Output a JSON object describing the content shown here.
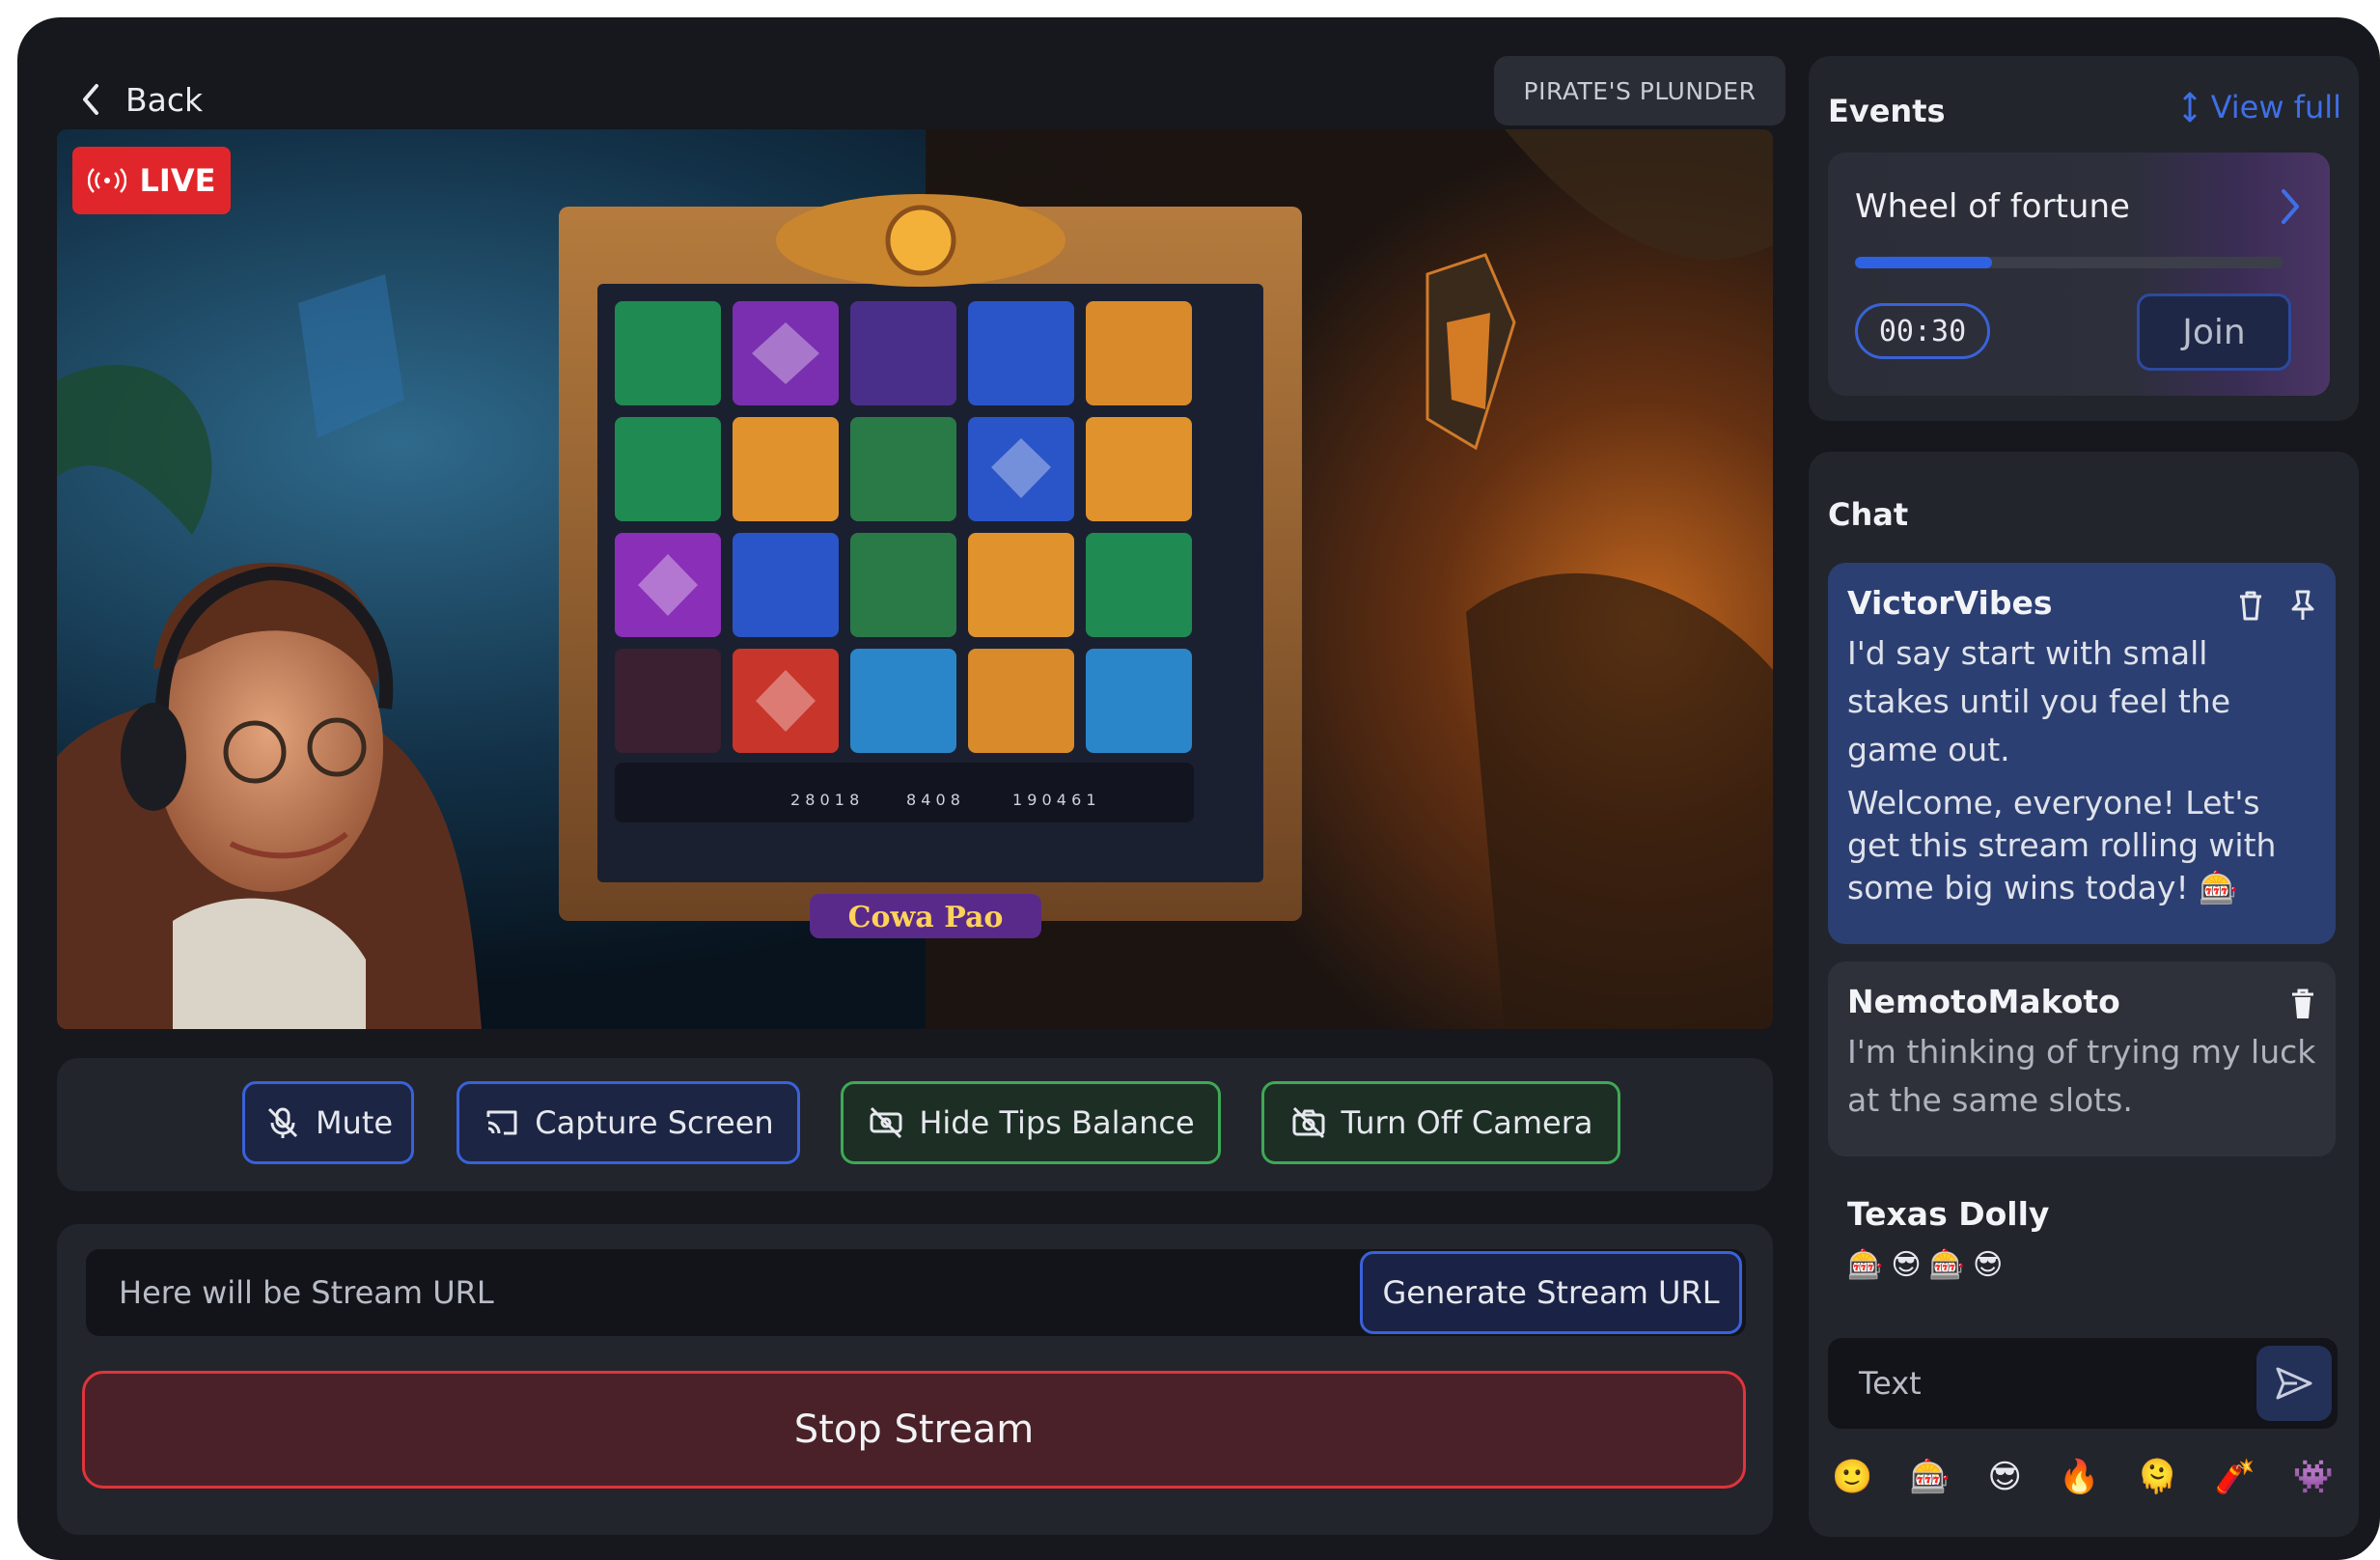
{
  "header": {
    "back_label": "Back",
    "game_name": "PIRATE'S PLUNDER"
  },
  "video": {
    "live_label": "LIVE",
    "slot_title": "Cowa Pao",
    "slot_stats": [
      "2 8 0 1 8",
      "8 4 0 8",
      "1 9 0 4 6 1"
    ]
  },
  "controls": {
    "mute_label": "Mute",
    "capture_label": "Capture Screen",
    "hide_tips_label": "Hide Tips Balance",
    "camera_label": "Turn Off Camera"
  },
  "stream": {
    "url_placeholder": "Here will be Stream URL",
    "generate_label": "Generate Stream URL",
    "stop_label": "Stop Stream"
  },
  "events": {
    "title": "Events",
    "view_full_label": "View full",
    "event_name": "Wheel of fortune",
    "progress": 0.32,
    "timer": "00:30",
    "join_label": "Join"
  },
  "chat": {
    "title": "Chat",
    "messages": [
      {
        "user": "VictorVibes",
        "text1": "I'd say start with small stakes until you feel the game out.",
        "text2": "Welcome, everyone! Let's get this stream rolling with some big wins today! 🎰"
      },
      {
        "user": "NemotoMakoto",
        "text1": "I'm thinking of trying my luck at the same slots."
      },
      {
        "user": "Texas Dolly",
        "emojis": [
          "🎰",
          "😎",
          "🎰",
          "😎"
        ]
      }
    ],
    "input_placeholder": "Text",
    "emoji_bar": [
      "🙂",
      "🎰",
      "😎",
      "🔥",
      "🫠",
      "🧨",
      "👾"
    ]
  },
  "colors": {
    "app_bg": "#16181d",
    "panel_bg": "#22252c",
    "accent_blue": "#3a62d8",
    "accent_green": "#3ea956",
    "danger_red": "#e0343c",
    "live_red": "#e0262b"
  }
}
